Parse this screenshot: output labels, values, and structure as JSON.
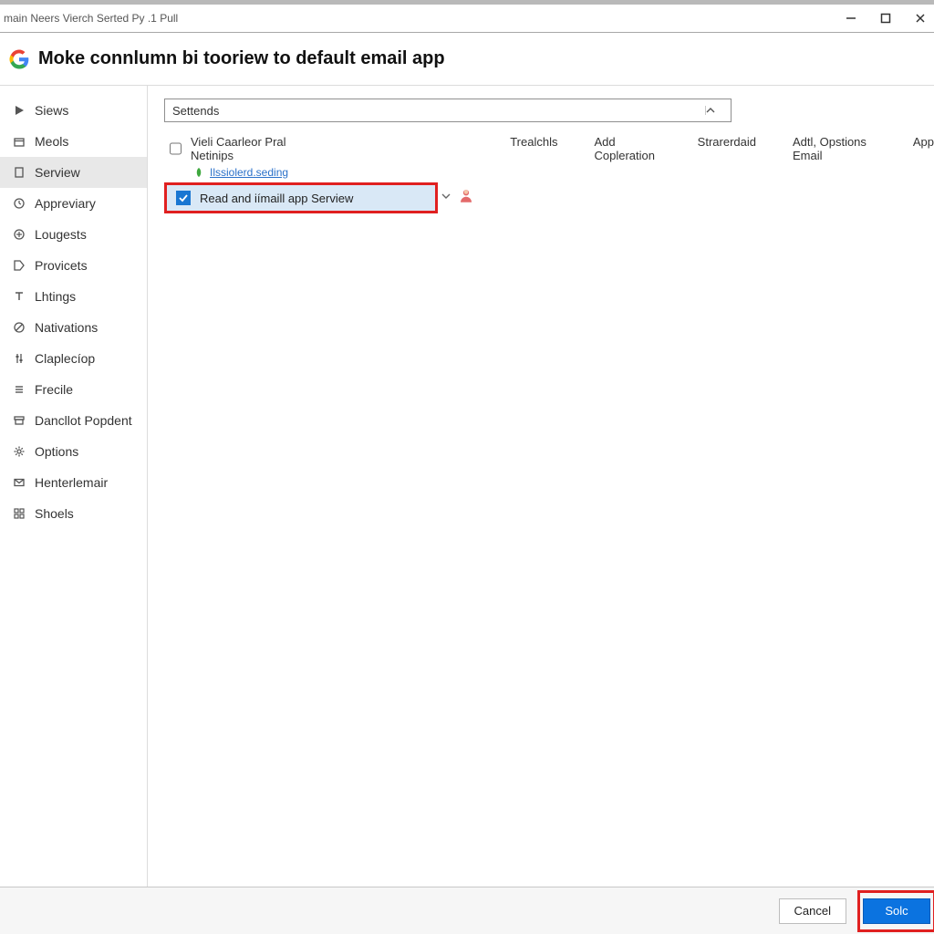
{
  "titlebar": {
    "text": "main Neers Vierch Serted Py .1 Pull"
  },
  "header": {
    "title": "Moke connlumn bi tooriew to default email app"
  },
  "sidebar": {
    "items": [
      {
        "label": "Siews"
      },
      {
        "label": "Meols"
      },
      {
        "label": "Serview"
      },
      {
        "label": "Appreviary"
      },
      {
        "label": "Lougests"
      },
      {
        "label": "Provicets"
      },
      {
        "label": "Lhtings"
      },
      {
        "label": "Nativations"
      },
      {
        "label": "Claplecíop"
      },
      {
        "label": "Frecile"
      },
      {
        "label": "Dancllot Popdent"
      },
      {
        "label": "Options"
      },
      {
        "label": "Henterlemair"
      },
      {
        "label": "Shoels"
      }
    ],
    "selected_index": 2
  },
  "main": {
    "combo": {
      "label": "Settends"
    },
    "header_row": {
      "first": "Vieli Caarleor Pral Netinips",
      "tabs": [
        "Trealchls",
        "Add Copleration",
        "Strarerdaid",
        "Adtl, Opstions Email",
        "App"
      ]
    },
    "sub_link": "Ilssiolerd.seding",
    "selected_row": {
      "label": "Read and iímaill app Serview",
      "checked": true
    }
  },
  "footer": {
    "cancel": "Cancel",
    "ok": "Solc"
  }
}
